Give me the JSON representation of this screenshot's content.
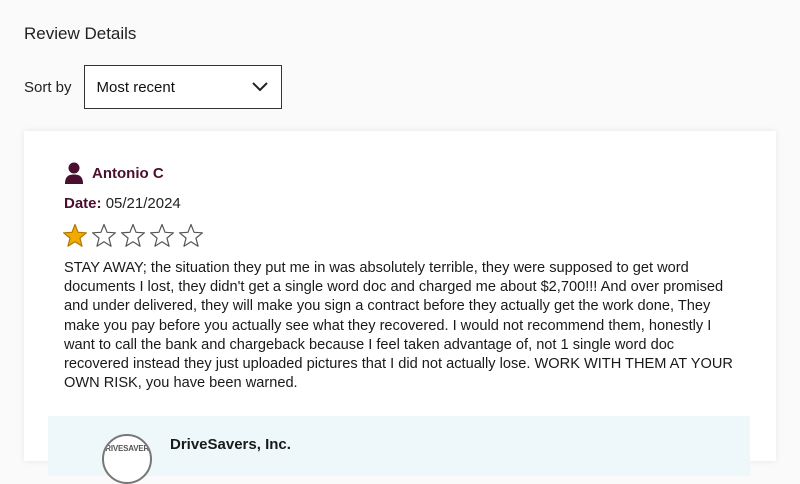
{
  "section": {
    "title": "Review Details"
  },
  "sort": {
    "label": "Sort by",
    "selected": "Most recent"
  },
  "review": {
    "reviewer_name": "Antonio C",
    "date_label": "Date:",
    "date_value": "05/21/2024",
    "rating": 1,
    "max_rating": 5,
    "text": "STAY AWAY; the situation they put me in was absolutely terrible, they were supposed to get word documents I lost, they didn't get a single word doc and charged me about $2,700!!! And over promised and under delivered, they will make you sign a contract before they actually get the work done, They make you pay before you actually see what they recovered. I would not recommend them, honestly I want to call the bank and chargeback because I feel taken advantage of, not 1 single word doc recovered instead they just uploaded pictures that I did not actually lose. WORK WITH THEM AT YOUR OWN RISK, you have been warned."
  },
  "reply": {
    "company_name": "DriveSavers, Inc.",
    "logo_text": "DRIVESAVERS"
  },
  "colors": {
    "accent": "#4a0e2e",
    "star_filled": "#f2a900",
    "reply_bg": "#eef8fb"
  }
}
